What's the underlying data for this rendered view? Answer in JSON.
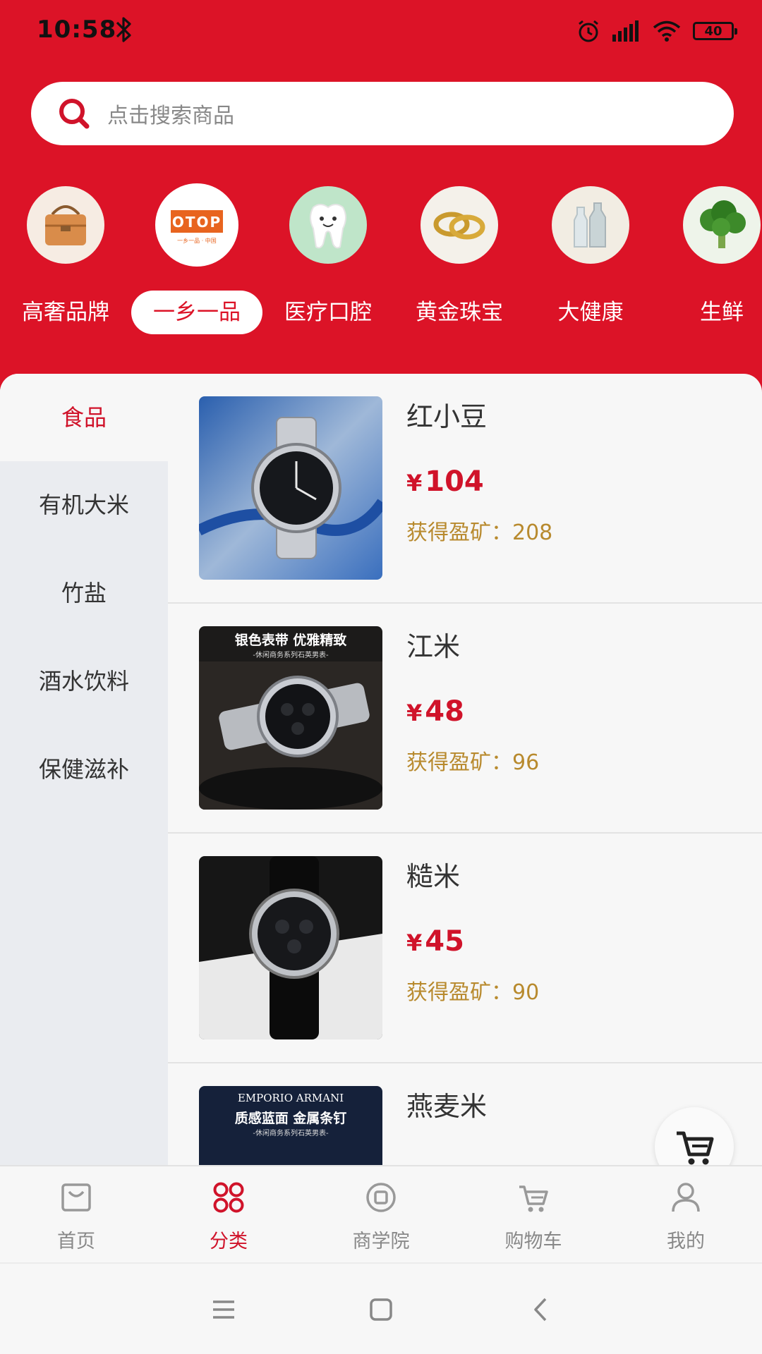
{
  "status_bar": {
    "time": "10:58",
    "battery": "40",
    "icons": [
      "bluetooth-icon",
      "alarm-icon",
      "signal-icon",
      "wifi-icon",
      "battery-icon"
    ]
  },
  "search": {
    "placeholder": "点击搜索商品"
  },
  "categories": [
    {
      "label": "高奢品牌",
      "icon": "handbag-icon",
      "selected": false
    },
    {
      "label": "一乡一品",
      "icon": "otop-logo-icon",
      "selected": true,
      "logo_text": "OTOP",
      "logo_sub": "一乡一品 · 中国"
    },
    {
      "label": "医疗口腔",
      "icon": "tooth-icon",
      "selected": false
    },
    {
      "label": "黄金珠宝",
      "icon": "gold-rings-icon",
      "selected": false
    },
    {
      "label": "大健康",
      "icon": "milk-bottles-icon",
      "selected": false
    },
    {
      "label": "生鲜",
      "icon": "broccoli-icon",
      "selected": false
    }
  ],
  "sidebar": {
    "items": [
      {
        "label": "食品",
        "active": true
      },
      {
        "label": "有机大米",
        "active": false
      },
      {
        "label": "竹盐",
        "active": false
      },
      {
        "label": "酒水饮料",
        "active": false
      },
      {
        "label": "保健滋补",
        "active": false
      }
    ]
  },
  "products": [
    {
      "name": "红小豆",
      "currency": "¥",
      "price": "104",
      "reward_label": "获得盈矿：",
      "reward": "208",
      "thumb": "silver-watch-blue-background-image"
    },
    {
      "name": "江米",
      "currency": "¥",
      "price": "48",
      "reward_label": "获得盈矿：",
      "reward": "96",
      "thumb": "silver-watch-dark-background-image",
      "thumb_title": "银色表带 优雅精致",
      "thumb_sub": "-休闲商务系列石英男表-"
    },
    {
      "name": "糙米",
      "currency": "¥",
      "price": "45",
      "reward_label": "获得盈矿：",
      "reward": "90",
      "thumb": "leather-watch-image"
    },
    {
      "name": "燕麦米",
      "thumb": "armani-watch-image",
      "thumb_brand": "EMPORIO ARMANI",
      "thumb_title": "质感蓝面 金属条钉",
      "thumb_sub": "-休闲商务系列石英男表-"
    }
  ],
  "tab_bar": {
    "tabs": [
      {
        "label": "首页",
        "icon": "home-bag-icon",
        "active": false
      },
      {
        "label": "分类",
        "icon": "category-grid-icon",
        "active": true
      },
      {
        "label": "商学院",
        "icon": "academy-icon",
        "active": false
      },
      {
        "label": "购物车",
        "icon": "cart-icon",
        "active": false
      },
      {
        "label": "我的",
        "icon": "user-icon",
        "active": false
      }
    ]
  },
  "colors": {
    "brand_red": "#dc1327",
    "price_red": "#d0132a",
    "reward_gold": "#b88a2e"
  }
}
